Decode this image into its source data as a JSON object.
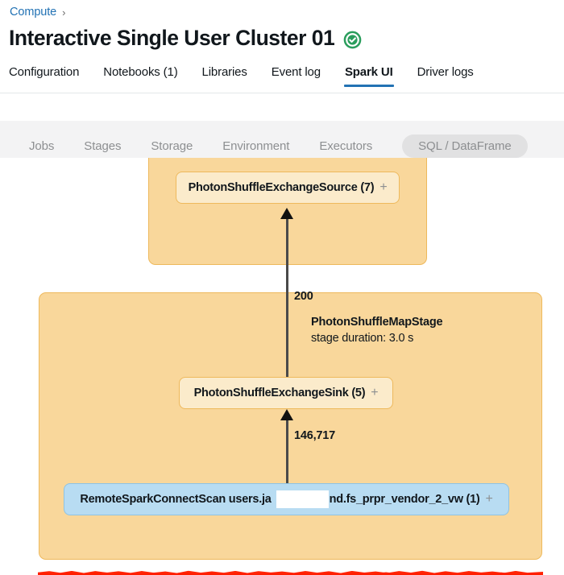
{
  "breadcrumb": {
    "link_label": "Compute",
    "separator": "›"
  },
  "header": {
    "title": "Interactive Single User Cluster 01",
    "status_icon": "check-circle-icon",
    "status_color": "#2A9D5C"
  },
  "tabs": [
    {
      "label": "Configuration",
      "active": false
    },
    {
      "label": "Notebooks (1)",
      "active": false
    },
    {
      "label": "Libraries",
      "active": false
    },
    {
      "label": "Event log",
      "active": false
    },
    {
      "label": "Spark UI",
      "active": true
    },
    {
      "label": "Driver logs",
      "active": false
    }
  ],
  "active_tab_underline_color": "#2272B4",
  "subnav": [
    {
      "label": "Jobs",
      "selected": false
    },
    {
      "label": "Stages",
      "selected": false
    },
    {
      "label": "Storage",
      "selected": false
    },
    {
      "label": "Environment",
      "selected": false
    },
    {
      "label": "Executors",
      "selected": false
    },
    {
      "label": "SQL / DataFrame",
      "selected": true
    }
  ],
  "graph": {
    "stage_container_fill": "#F9D79B",
    "stage_container_border": "#EEB95C",
    "node_cream_fill": "#FBEBCB",
    "node_blue_fill": "#B8DCF2",
    "annotation_color": "#FF1F00",
    "top_stage": {
      "node": {
        "label": "PhotonShuffleExchangeSource (7)",
        "expand": "+"
      }
    },
    "map_stage": {
      "name": "PhotonShuffleMapStage",
      "duration": "stage duration: 3.0 s",
      "sink_node": {
        "label": "PhotonShuffleExchangeSink (5)",
        "expand": "+"
      },
      "scan_node": {
        "label_before_redaction": "RemoteSparkConnectScan users.ja",
        "label_after_redaction": "nd.fs_prpr_vendor_2_vw (1)",
        "expand": "+",
        "redacted": true
      }
    },
    "edges": [
      {
        "label": "200",
        "from": "PhotonShuffleExchangeSink (5)",
        "to": "PhotonShuffleExchangeSource (7)"
      },
      {
        "label": "146,717",
        "from": "RemoteSparkConnectScan users.ja██nd.fs_prpr_vendor_2_vw (1)",
        "to": "PhotonShuffleExchangeSink (5)"
      }
    ]
  }
}
